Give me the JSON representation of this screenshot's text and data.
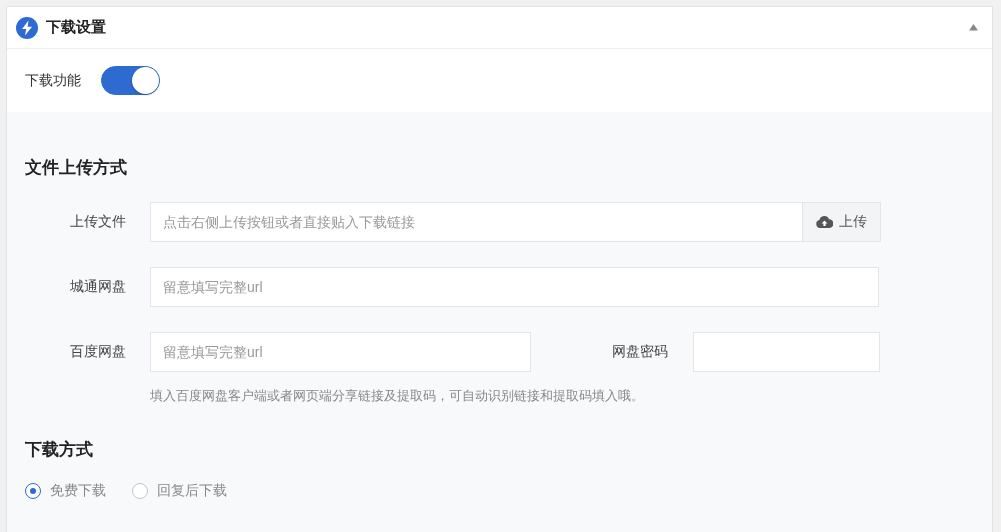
{
  "panel": {
    "title": "下载设置",
    "expanded": true
  },
  "download_toggle": {
    "label": "下载功能",
    "on": true
  },
  "upload_section": {
    "title": "文件上传方式",
    "fields": [
      {
        "kind": "upload",
        "label": "上传文件",
        "placeholder": "点击右侧上传按钮或者直接贴入下载链接",
        "button": "上传"
      },
      {
        "kind": "url",
        "label": "城通网盘",
        "placeholder": "留意填写完整url"
      },
      {
        "kind": "pair",
        "label": "百度网盘",
        "placeholder": "留意填写完整url",
        "second_label": "网盘密码"
      }
    ],
    "help": "填入百度网盘客户端或者网页端分享链接及提取码，可自动识别链接和提取码填入哦。"
  },
  "download_mode": {
    "title": "下载方式",
    "options": [
      {
        "label": "免费下载",
        "selected": true
      },
      {
        "label": "回复后下载",
        "selected": false
      }
    ]
  }
}
